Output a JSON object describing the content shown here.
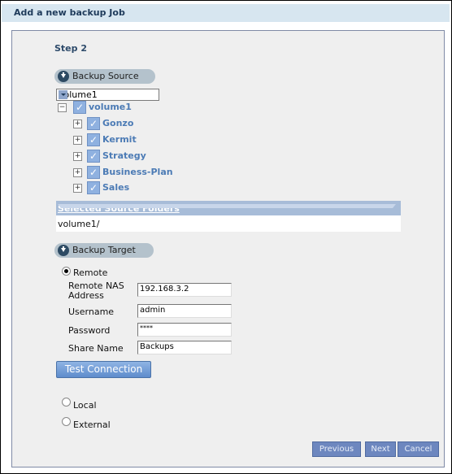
{
  "title": "Add a new backup Job",
  "step": "Step 2",
  "source": {
    "header": "Backup Source",
    "volume_select": "volume1",
    "tree": {
      "root": "volume1",
      "children": [
        "Gonzo",
        "Kermit",
        "Strategy",
        "Business-Plan",
        "Sales"
      ]
    },
    "selected_header": "Selected Source Folders",
    "selected_value": "volume1/"
  },
  "target": {
    "header": "Backup Target",
    "options": [
      "Remote",
      "Local",
      "External"
    ],
    "selected": "Remote",
    "fields": {
      "address_label": "Remote NAS Address",
      "address_value": "192.168.3.2",
      "username_label": "Username",
      "username_value": "admin",
      "password_label": "Password",
      "password_value": "****",
      "share_label": "Share Name",
      "share_value": "Backups"
    },
    "test_button": "Test Connection"
  },
  "nav": {
    "previous": "Previous",
    "next": "Next",
    "cancel": "Cancel"
  }
}
